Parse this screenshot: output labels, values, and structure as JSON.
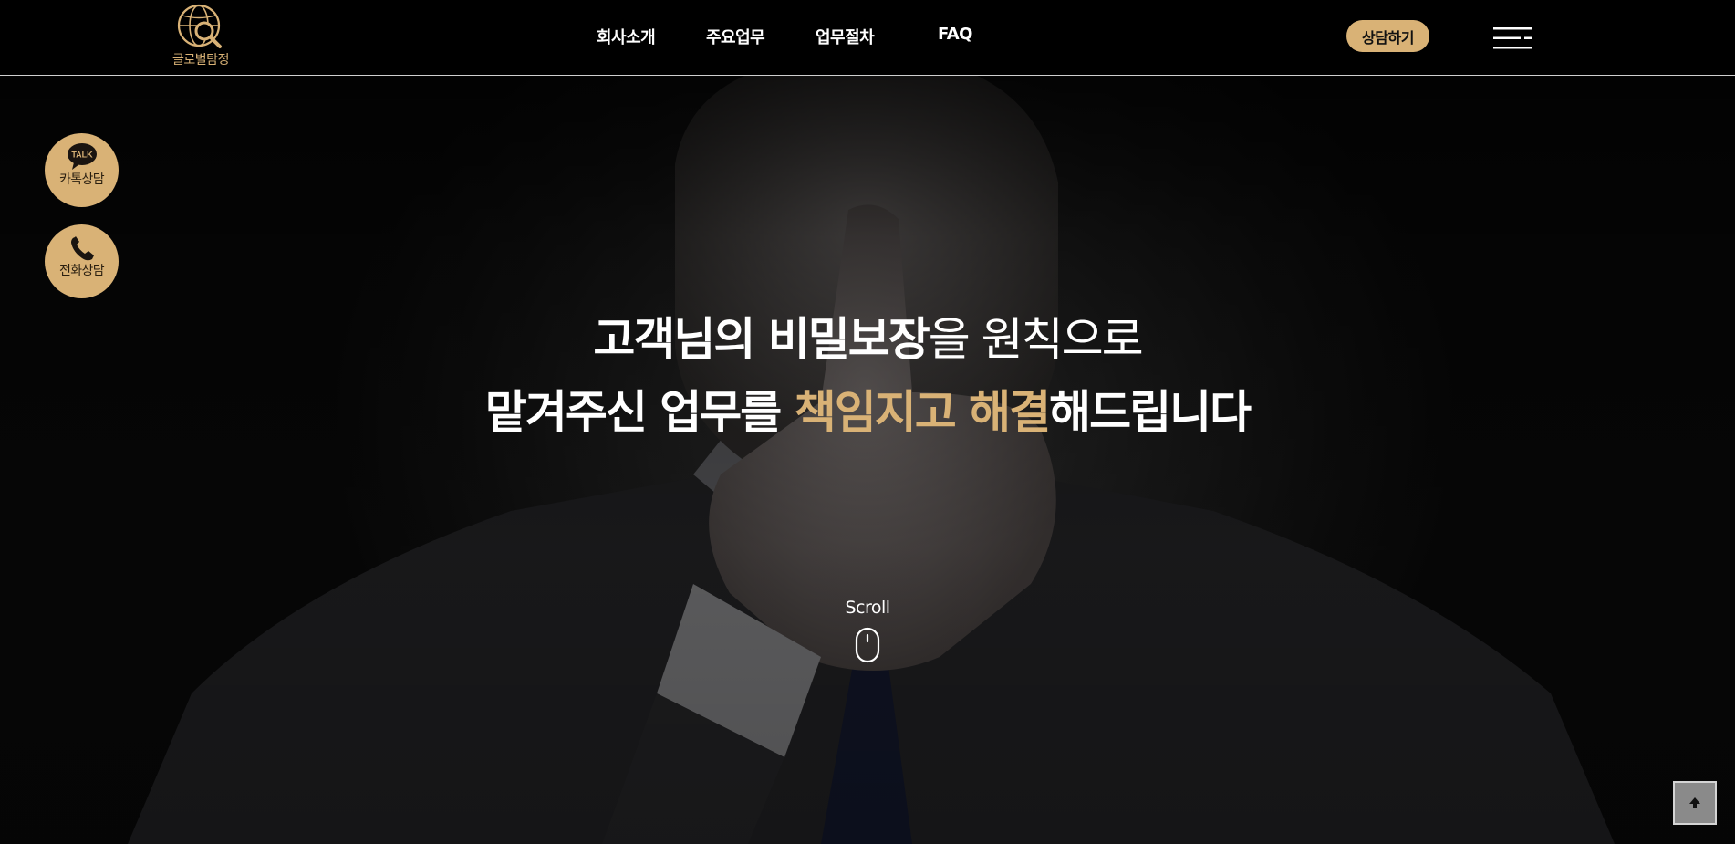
{
  "brand": {
    "logo_text": "글로벌탐정",
    "logo_icon": "globe-magnifier-icon",
    "accent_color": "#d9b276"
  },
  "nav": {
    "items": [
      "회사소개",
      "주요업무",
      "업무절차",
      "FAQ"
    ]
  },
  "header": {
    "consult_label": "상담하기",
    "menu_icon": "hamburger-menu-icon"
  },
  "side_buttons": [
    {
      "label": "카톡상담",
      "icon": "kakao-talk-icon",
      "badge": "TALK"
    },
    {
      "label": "전화상담",
      "icon": "phone-icon"
    }
  ],
  "hero": {
    "line1": {
      "part1": "고객님의 비밀보장",
      "part2": "을 원칙으로"
    },
    "line2": {
      "part1": "맡겨주신 업무를 ",
      "part2": "책임지고 해결",
      "part3": "해드립니다"
    }
  },
  "scroll": {
    "label": "Scroll",
    "icon": "mouse-icon"
  },
  "top_button": {
    "icon": "arrow-up-icon"
  }
}
